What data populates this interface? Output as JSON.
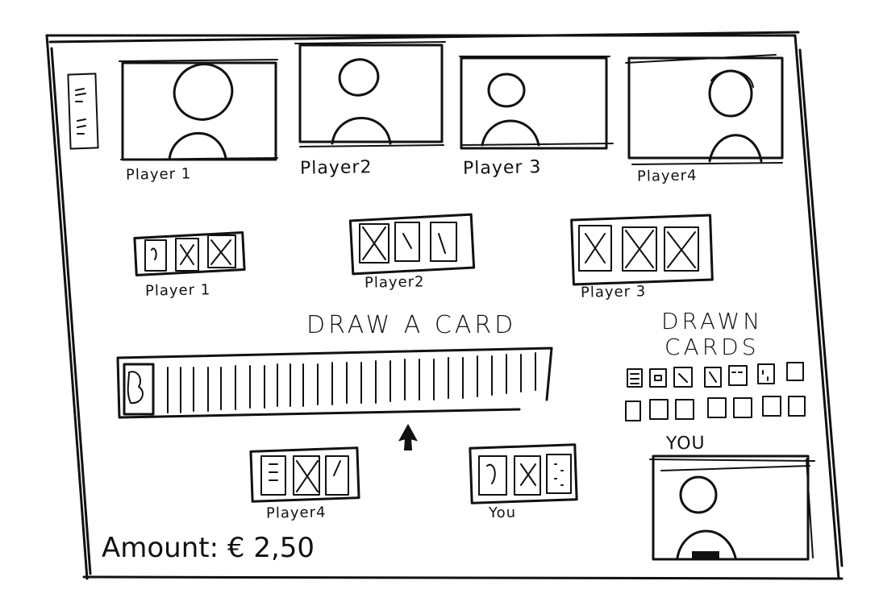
{
  "players_top": [
    {
      "label": "Player 1"
    },
    {
      "label": "Player2"
    },
    {
      "label": "Player 3"
    },
    {
      "label": "Player4"
    }
  ],
  "hands": [
    {
      "label": "Player 1"
    },
    {
      "label": "Player2"
    },
    {
      "label": "Player 3"
    },
    {
      "label": "Player4"
    },
    {
      "label": "You"
    }
  ],
  "deck": {
    "title": "DRAW A CARD"
  },
  "drawn": {
    "title_line1": "DRAWN",
    "title_line2": "CARDS"
  },
  "you": {
    "label": "YOU"
  },
  "amount": {
    "label": "Amount:",
    "value": "€ 2,50"
  }
}
